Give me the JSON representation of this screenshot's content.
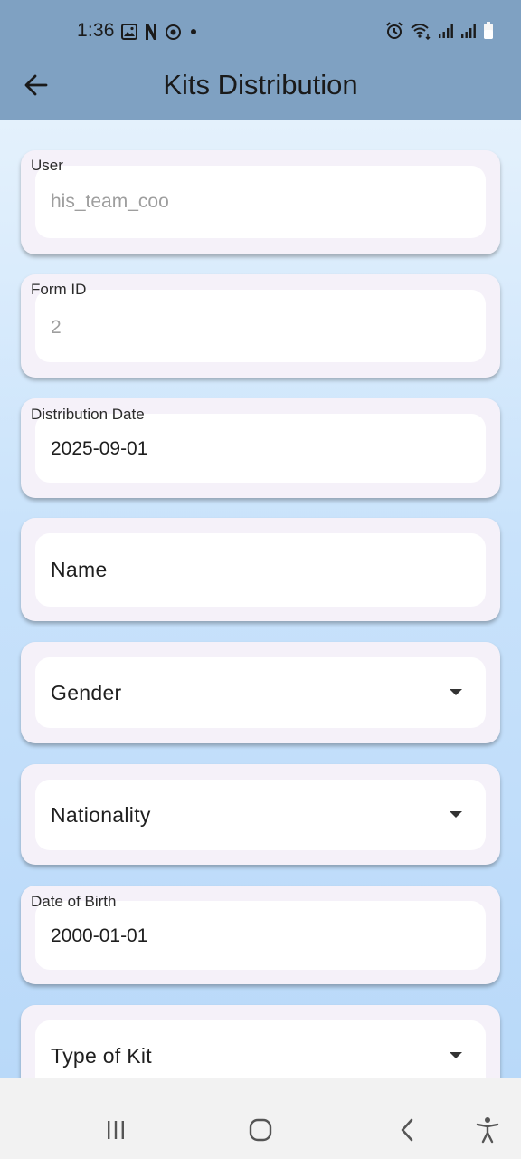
{
  "status_bar": {
    "time": "1:36",
    "left_icons": [
      "image-icon",
      "n-icon",
      "sync-icon",
      "dot-icon"
    ],
    "right_icons": [
      "alarm-icon",
      "wifi-icon",
      "signal-icon",
      "signal-icon",
      "battery-icon"
    ]
  },
  "app_bar": {
    "title": "Kits Distribution",
    "back_icon": "arrow-left-icon"
  },
  "form": {
    "user": {
      "label": "User",
      "value": "his_team_coo"
    },
    "form_id": {
      "label": "Form ID",
      "value": "2"
    },
    "distribution_date": {
      "label": "Distribution Date",
      "value": "2025-09-01"
    },
    "name": {
      "label": "Name"
    },
    "gender": {
      "label": "Gender"
    },
    "nationality": {
      "label": "Nationality"
    },
    "date_of_birth": {
      "label": "Date of Birth",
      "value": "2000-01-01"
    },
    "type_of_kit": {
      "label": "Type of Kit"
    }
  },
  "nav_bar": {
    "icons": [
      "recent-apps-icon",
      "home-icon",
      "back-icon",
      "accessibility-icon"
    ]
  },
  "colors": {
    "header": "#7fa1c2",
    "card": "#f5f1f9",
    "background_top": "#e4f1fc",
    "background_bottom": "#b9d9f9"
  }
}
